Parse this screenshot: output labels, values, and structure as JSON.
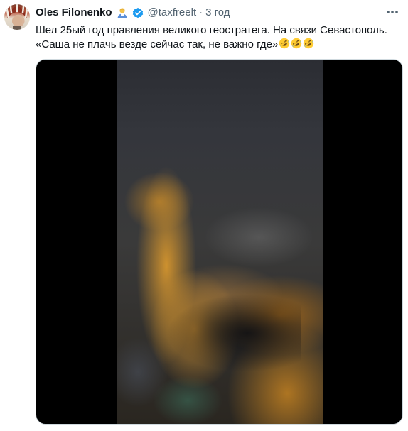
{
  "tweet": {
    "author_name": "Oles Filonenko",
    "handle": "@taxfreelt",
    "separator": "·",
    "timestamp": "3 год",
    "text_line1": "Шел 25ый год правления великого геостратега. На связи Севастополь.",
    "text_line2": "«Саша не плачь везде сейчас так, не важно где»",
    "emoji_count": 3,
    "media_type": "video"
  },
  "colors": {
    "text_primary": "#0f1419",
    "text_secondary": "#536471",
    "verified_blue": "#1d9bf0",
    "media_background": "#000000"
  },
  "icons": {
    "verified": "verified-badge-icon",
    "name_emoji": "person-emoji-icon",
    "more": "more-options-icon",
    "rofl": "rolling-on-floor-laughing-emoji-icon"
  }
}
